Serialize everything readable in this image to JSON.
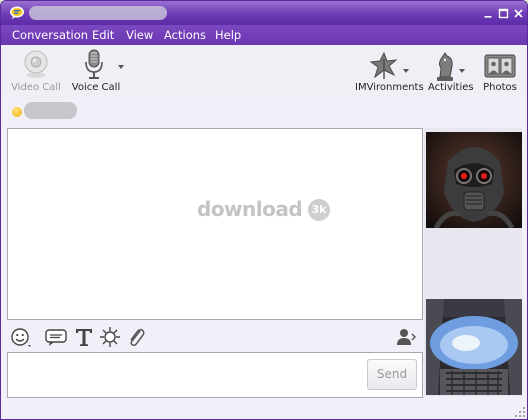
{
  "app": {
    "icon": "yahoo-messenger-icon",
    "accent": "#6e3cb6"
  },
  "window_controls": [
    "minimize-icon",
    "maximize-icon",
    "close-icon"
  ],
  "menu": {
    "items": [
      "Conversation",
      "Edit",
      "View",
      "Actions",
      "Help"
    ]
  },
  "toolbar": {
    "video_call": "Video Call",
    "voice_call": "Voice Call",
    "imvironments": "IMVironments",
    "activities": "Activities",
    "photos": "Photos"
  },
  "conversation": {
    "watermark": "download",
    "watermark_badge": "3k"
  },
  "compose": {
    "send_label": "Send",
    "format_icons": [
      "smiley-icon",
      "audibles-icon",
      "text-format-icon",
      "nudge-icon",
      "attachment-icon"
    ],
    "contact_icon": "contact-details-icon"
  }
}
